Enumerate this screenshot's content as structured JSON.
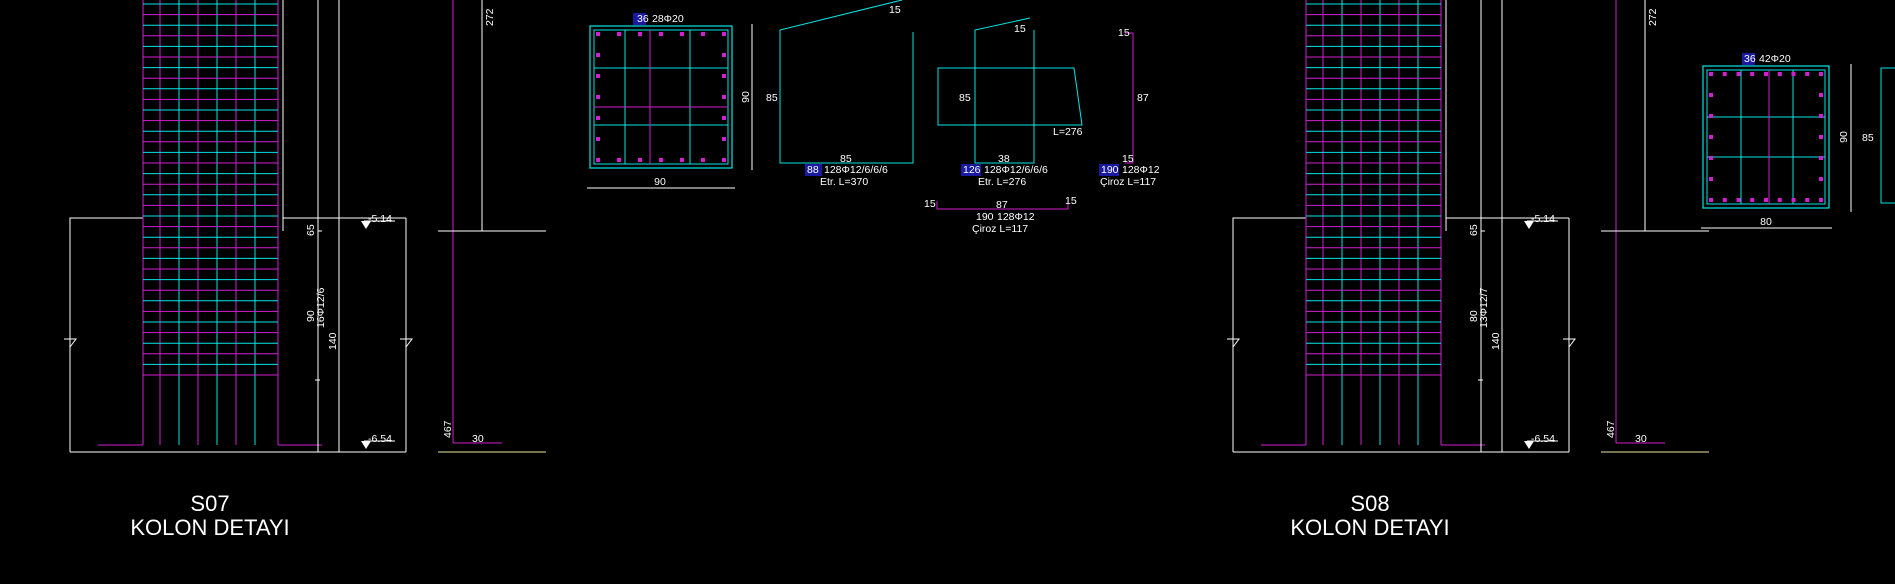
{
  "colors": {
    "background": "#000000",
    "outline": "#ffffff",
    "stirrup": "#00e5e5",
    "bar": "#d020d0",
    "highlight": "#1a1aa0",
    "ground": "#e8e8a0"
  },
  "col1": {
    "title_code": "S07",
    "title_text": "KOLON DETAYI",
    "dim_272": "272",
    "dim_65": "65",
    "dim_90": "90",
    "dim_140": "140",
    "dim_467": "467",
    "dim_30": "30",
    "stirrups": "16Φ12/6",
    "level_top": "-5.14",
    "level_bottom": "-6.54"
  },
  "col2": {
    "title_code": "S08",
    "title_text": "KOLON DETAYI",
    "dim_272": "272",
    "dim_65": "65",
    "dim_80": "80",
    "dim_140": "140",
    "dim_467": "467",
    "dim_30": "30",
    "stirrups": "13Φ12/7",
    "level_top": "-5.14",
    "level_bottom": "-6.54"
  },
  "section1": {
    "bars_num": "36",
    "bars_text": "28Φ20",
    "width": "90",
    "height": "90"
  },
  "section2": {
    "bars_num": "36",
    "bars_text": "42Φ20",
    "width": "80",
    "height": "90",
    "inner": "85"
  },
  "stirrup1": {
    "top": "15",
    "side": "85",
    "bottom": "85",
    "num": "88",
    "spec": "128Φ12/6/6/6",
    "length": "Etr. L=370"
  },
  "stirrup2": {
    "top": "15",
    "side": "85",
    "bottom": "38",
    "label_l": "L=276",
    "num": "126",
    "spec": "128Φ12/6/6/6",
    "length": "Etr. L=276"
  },
  "tie1": {
    "top": "15",
    "side": "87",
    "bottom": "15",
    "num": "190",
    "spec": "128Φ12",
    "length": "Çiroz L=117"
  },
  "tie2": {
    "left": "15",
    "mid": "87",
    "right": "15",
    "num": "190",
    "spec": "128Φ12",
    "length": "Çiroz L=117"
  }
}
